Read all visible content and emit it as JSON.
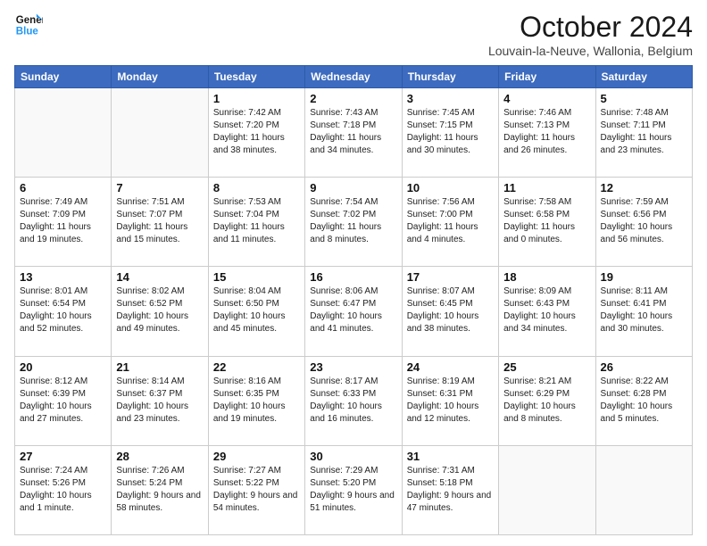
{
  "header": {
    "logo_line1": "General",
    "logo_line2": "Blue",
    "title": "October 2024",
    "subtitle": "Louvain-la-Neuve, Wallonia, Belgium"
  },
  "weekdays": [
    "Sunday",
    "Monday",
    "Tuesday",
    "Wednesday",
    "Thursday",
    "Friday",
    "Saturday"
  ],
  "weeks": [
    [
      {
        "day": "",
        "sunrise": "",
        "sunset": "",
        "daylight": ""
      },
      {
        "day": "",
        "sunrise": "",
        "sunset": "",
        "daylight": ""
      },
      {
        "day": "1",
        "sunrise": "Sunrise: 7:42 AM",
        "sunset": "Sunset: 7:20 PM",
        "daylight": "Daylight: 11 hours and 38 minutes."
      },
      {
        "day": "2",
        "sunrise": "Sunrise: 7:43 AM",
        "sunset": "Sunset: 7:18 PM",
        "daylight": "Daylight: 11 hours and 34 minutes."
      },
      {
        "day": "3",
        "sunrise": "Sunrise: 7:45 AM",
        "sunset": "Sunset: 7:15 PM",
        "daylight": "Daylight: 11 hours and 30 minutes."
      },
      {
        "day": "4",
        "sunrise": "Sunrise: 7:46 AM",
        "sunset": "Sunset: 7:13 PM",
        "daylight": "Daylight: 11 hours and 26 minutes."
      },
      {
        "day": "5",
        "sunrise": "Sunrise: 7:48 AM",
        "sunset": "Sunset: 7:11 PM",
        "daylight": "Daylight: 11 hours and 23 minutes."
      }
    ],
    [
      {
        "day": "6",
        "sunrise": "Sunrise: 7:49 AM",
        "sunset": "Sunset: 7:09 PM",
        "daylight": "Daylight: 11 hours and 19 minutes."
      },
      {
        "day": "7",
        "sunrise": "Sunrise: 7:51 AM",
        "sunset": "Sunset: 7:07 PM",
        "daylight": "Daylight: 11 hours and 15 minutes."
      },
      {
        "day": "8",
        "sunrise": "Sunrise: 7:53 AM",
        "sunset": "Sunset: 7:04 PM",
        "daylight": "Daylight: 11 hours and 11 minutes."
      },
      {
        "day": "9",
        "sunrise": "Sunrise: 7:54 AM",
        "sunset": "Sunset: 7:02 PM",
        "daylight": "Daylight: 11 hours and 8 minutes."
      },
      {
        "day": "10",
        "sunrise": "Sunrise: 7:56 AM",
        "sunset": "Sunset: 7:00 PM",
        "daylight": "Daylight: 11 hours and 4 minutes."
      },
      {
        "day": "11",
        "sunrise": "Sunrise: 7:58 AM",
        "sunset": "Sunset: 6:58 PM",
        "daylight": "Daylight: 11 hours and 0 minutes."
      },
      {
        "day": "12",
        "sunrise": "Sunrise: 7:59 AM",
        "sunset": "Sunset: 6:56 PM",
        "daylight": "Daylight: 10 hours and 56 minutes."
      }
    ],
    [
      {
        "day": "13",
        "sunrise": "Sunrise: 8:01 AM",
        "sunset": "Sunset: 6:54 PM",
        "daylight": "Daylight: 10 hours and 52 minutes."
      },
      {
        "day": "14",
        "sunrise": "Sunrise: 8:02 AM",
        "sunset": "Sunset: 6:52 PM",
        "daylight": "Daylight: 10 hours and 49 minutes."
      },
      {
        "day": "15",
        "sunrise": "Sunrise: 8:04 AM",
        "sunset": "Sunset: 6:50 PM",
        "daylight": "Daylight: 10 hours and 45 minutes."
      },
      {
        "day": "16",
        "sunrise": "Sunrise: 8:06 AM",
        "sunset": "Sunset: 6:47 PM",
        "daylight": "Daylight: 10 hours and 41 minutes."
      },
      {
        "day": "17",
        "sunrise": "Sunrise: 8:07 AM",
        "sunset": "Sunset: 6:45 PM",
        "daylight": "Daylight: 10 hours and 38 minutes."
      },
      {
        "day": "18",
        "sunrise": "Sunrise: 8:09 AM",
        "sunset": "Sunset: 6:43 PM",
        "daylight": "Daylight: 10 hours and 34 minutes."
      },
      {
        "day": "19",
        "sunrise": "Sunrise: 8:11 AM",
        "sunset": "Sunset: 6:41 PM",
        "daylight": "Daylight: 10 hours and 30 minutes."
      }
    ],
    [
      {
        "day": "20",
        "sunrise": "Sunrise: 8:12 AM",
        "sunset": "Sunset: 6:39 PM",
        "daylight": "Daylight: 10 hours and 27 minutes."
      },
      {
        "day": "21",
        "sunrise": "Sunrise: 8:14 AM",
        "sunset": "Sunset: 6:37 PM",
        "daylight": "Daylight: 10 hours and 23 minutes."
      },
      {
        "day": "22",
        "sunrise": "Sunrise: 8:16 AM",
        "sunset": "Sunset: 6:35 PM",
        "daylight": "Daylight: 10 hours and 19 minutes."
      },
      {
        "day": "23",
        "sunrise": "Sunrise: 8:17 AM",
        "sunset": "Sunset: 6:33 PM",
        "daylight": "Daylight: 10 hours and 16 minutes."
      },
      {
        "day": "24",
        "sunrise": "Sunrise: 8:19 AM",
        "sunset": "Sunset: 6:31 PM",
        "daylight": "Daylight: 10 hours and 12 minutes."
      },
      {
        "day": "25",
        "sunrise": "Sunrise: 8:21 AM",
        "sunset": "Sunset: 6:29 PM",
        "daylight": "Daylight: 10 hours and 8 minutes."
      },
      {
        "day": "26",
        "sunrise": "Sunrise: 8:22 AM",
        "sunset": "Sunset: 6:28 PM",
        "daylight": "Daylight: 10 hours and 5 minutes."
      }
    ],
    [
      {
        "day": "27",
        "sunrise": "Sunrise: 7:24 AM",
        "sunset": "Sunset: 5:26 PM",
        "daylight": "Daylight: 10 hours and 1 minute."
      },
      {
        "day": "28",
        "sunrise": "Sunrise: 7:26 AM",
        "sunset": "Sunset: 5:24 PM",
        "daylight": "Daylight: 9 hours and 58 minutes."
      },
      {
        "day": "29",
        "sunrise": "Sunrise: 7:27 AM",
        "sunset": "Sunset: 5:22 PM",
        "daylight": "Daylight: 9 hours and 54 minutes."
      },
      {
        "day": "30",
        "sunrise": "Sunrise: 7:29 AM",
        "sunset": "Sunset: 5:20 PM",
        "daylight": "Daylight: 9 hours and 51 minutes."
      },
      {
        "day": "31",
        "sunrise": "Sunrise: 7:31 AM",
        "sunset": "Sunset: 5:18 PM",
        "daylight": "Daylight: 9 hours and 47 minutes."
      },
      {
        "day": "",
        "sunrise": "",
        "sunset": "",
        "daylight": ""
      },
      {
        "day": "",
        "sunrise": "",
        "sunset": "",
        "daylight": ""
      }
    ]
  ]
}
